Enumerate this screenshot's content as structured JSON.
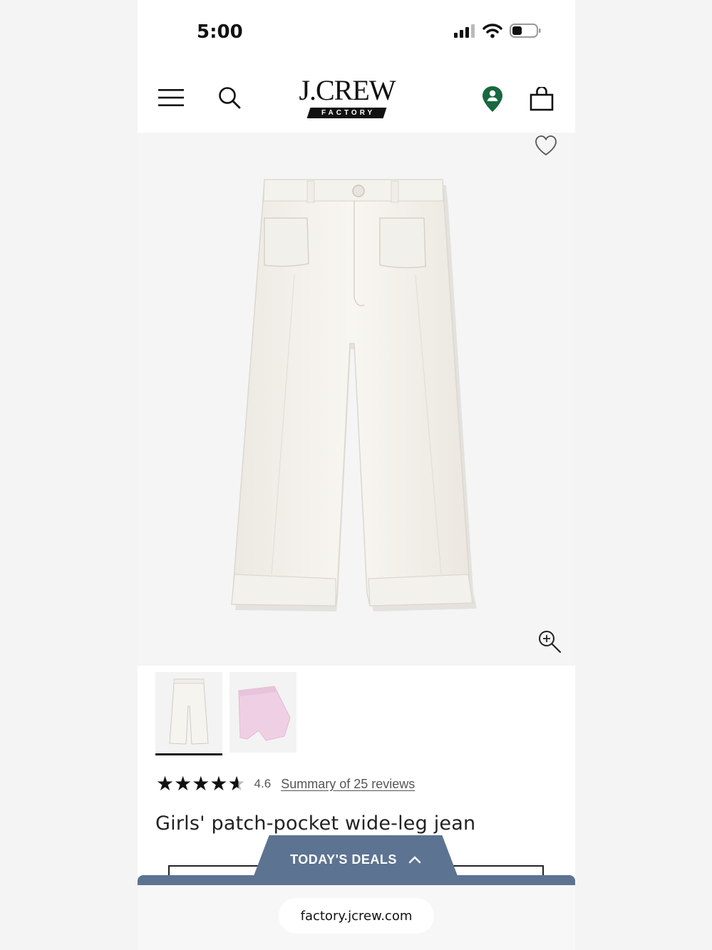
{
  "status_bar": {
    "time": "5:00",
    "icons": [
      "signal-icon",
      "wifi-icon",
      "battery-icon"
    ]
  },
  "header": {
    "logo_main": "J.CREW",
    "logo_sub": "FACTORY",
    "icons": [
      "hamburger-menu-icon",
      "search-icon",
      "store-locator-icon",
      "shopping-bag-icon"
    ],
    "store_icon_color": "#17683f"
  },
  "product": {
    "title": "Girls' patch-pocket wide-leg jean",
    "rating": 4.6,
    "rating_label": "4.6",
    "reviews_link": "Summary of 25 reviews",
    "thumbnails": [
      {
        "color": "white",
        "selected": true
      },
      {
        "color": "pink",
        "selected": false
      }
    ]
  },
  "deals": {
    "label": "TODAY'S DEALS",
    "color": "#5c7392"
  },
  "browser": {
    "url": "factory.jcrew.com"
  }
}
